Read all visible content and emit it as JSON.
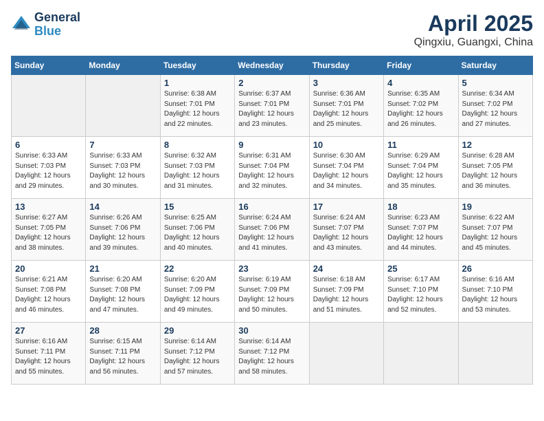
{
  "header": {
    "logo_general": "General",
    "logo_blue": "Blue",
    "month_title": "April 2025",
    "location": "Qingxiu, Guangxi, China"
  },
  "days_of_week": [
    "Sunday",
    "Monday",
    "Tuesday",
    "Wednesday",
    "Thursday",
    "Friday",
    "Saturday"
  ],
  "weeks": [
    [
      {
        "day": "",
        "info": ""
      },
      {
        "day": "",
        "info": ""
      },
      {
        "day": "1",
        "info": "Sunrise: 6:38 AM\nSunset: 7:01 PM\nDaylight: 12 hours and 22 minutes."
      },
      {
        "day": "2",
        "info": "Sunrise: 6:37 AM\nSunset: 7:01 PM\nDaylight: 12 hours and 23 minutes."
      },
      {
        "day": "3",
        "info": "Sunrise: 6:36 AM\nSunset: 7:01 PM\nDaylight: 12 hours and 25 minutes."
      },
      {
        "day": "4",
        "info": "Sunrise: 6:35 AM\nSunset: 7:02 PM\nDaylight: 12 hours and 26 minutes."
      },
      {
        "day": "5",
        "info": "Sunrise: 6:34 AM\nSunset: 7:02 PM\nDaylight: 12 hours and 27 minutes."
      }
    ],
    [
      {
        "day": "6",
        "info": "Sunrise: 6:33 AM\nSunset: 7:03 PM\nDaylight: 12 hours and 29 minutes."
      },
      {
        "day": "7",
        "info": "Sunrise: 6:33 AM\nSunset: 7:03 PM\nDaylight: 12 hours and 30 minutes."
      },
      {
        "day": "8",
        "info": "Sunrise: 6:32 AM\nSunset: 7:03 PM\nDaylight: 12 hours and 31 minutes."
      },
      {
        "day": "9",
        "info": "Sunrise: 6:31 AM\nSunset: 7:04 PM\nDaylight: 12 hours and 32 minutes."
      },
      {
        "day": "10",
        "info": "Sunrise: 6:30 AM\nSunset: 7:04 PM\nDaylight: 12 hours and 34 minutes."
      },
      {
        "day": "11",
        "info": "Sunrise: 6:29 AM\nSunset: 7:04 PM\nDaylight: 12 hours and 35 minutes."
      },
      {
        "day": "12",
        "info": "Sunrise: 6:28 AM\nSunset: 7:05 PM\nDaylight: 12 hours and 36 minutes."
      }
    ],
    [
      {
        "day": "13",
        "info": "Sunrise: 6:27 AM\nSunset: 7:05 PM\nDaylight: 12 hours and 38 minutes."
      },
      {
        "day": "14",
        "info": "Sunrise: 6:26 AM\nSunset: 7:06 PM\nDaylight: 12 hours and 39 minutes."
      },
      {
        "day": "15",
        "info": "Sunrise: 6:25 AM\nSunset: 7:06 PM\nDaylight: 12 hours and 40 minutes."
      },
      {
        "day": "16",
        "info": "Sunrise: 6:24 AM\nSunset: 7:06 PM\nDaylight: 12 hours and 41 minutes."
      },
      {
        "day": "17",
        "info": "Sunrise: 6:24 AM\nSunset: 7:07 PM\nDaylight: 12 hours and 43 minutes."
      },
      {
        "day": "18",
        "info": "Sunrise: 6:23 AM\nSunset: 7:07 PM\nDaylight: 12 hours and 44 minutes."
      },
      {
        "day": "19",
        "info": "Sunrise: 6:22 AM\nSunset: 7:07 PM\nDaylight: 12 hours and 45 minutes."
      }
    ],
    [
      {
        "day": "20",
        "info": "Sunrise: 6:21 AM\nSunset: 7:08 PM\nDaylight: 12 hours and 46 minutes."
      },
      {
        "day": "21",
        "info": "Sunrise: 6:20 AM\nSunset: 7:08 PM\nDaylight: 12 hours and 47 minutes."
      },
      {
        "day": "22",
        "info": "Sunrise: 6:20 AM\nSunset: 7:09 PM\nDaylight: 12 hours and 49 minutes."
      },
      {
        "day": "23",
        "info": "Sunrise: 6:19 AM\nSunset: 7:09 PM\nDaylight: 12 hours and 50 minutes."
      },
      {
        "day": "24",
        "info": "Sunrise: 6:18 AM\nSunset: 7:09 PM\nDaylight: 12 hours and 51 minutes."
      },
      {
        "day": "25",
        "info": "Sunrise: 6:17 AM\nSunset: 7:10 PM\nDaylight: 12 hours and 52 minutes."
      },
      {
        "day": "26",
        "info": "Sunrise: 6:16 AM\nSunset: 7:10 PM\nDaylight: 12 hours and 53 minutes."
      }
    ],
    [
      {
        "day": "27",
        "info": "Sunrise: 6:16 AM\nSunset: 7:11 PM\nDaylight: 12 hours and 55 minutes."
      },
      {
        "day": "28",
        "info": "Sunrise: 6:15 AM\nSunset: 7:11 PM\nDaylight: 12 hours and 56 minutes."
      },
      {
        "day": "29",
        "info": "Sunrise: 6:14 AM\nSunset: 7:12 PM\nDaylight: 12 hours and 57 minutes."
      },
      {
        "day": "30",
        "info": "Sunrise: 6:14 AM\nSunset: 7:12 PM\nDaylight: 12 hours and 58 minutes."
      },
      {
        "day": "",
        "info": ""
      },
      {
        "day": "",
        "info": ""
      },
      {
        "day": "",
        "info": ""
      }
    ]
  ]
}
